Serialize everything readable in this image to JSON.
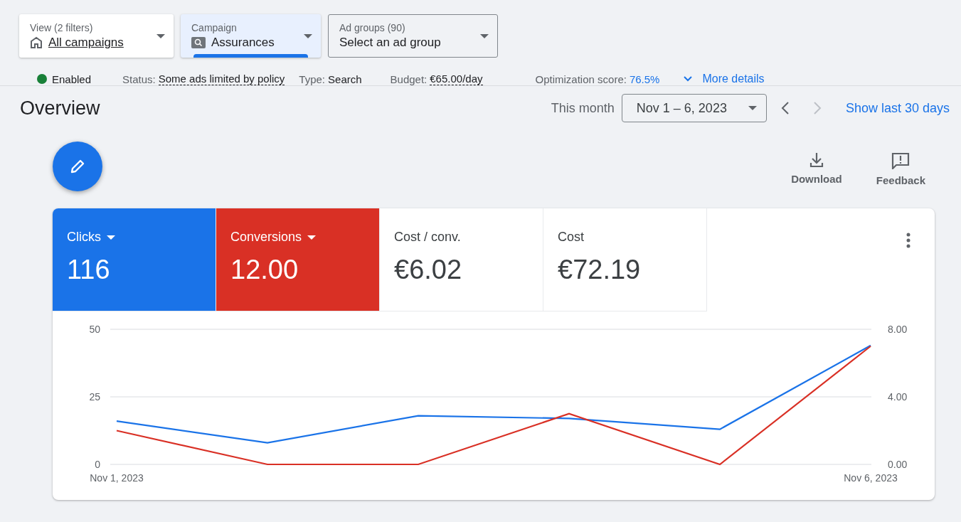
{
  "filters": [
    {
      "kind": "view",
      "label": "View (2 filters)",
      "value": "All campaigns",
      "selected": false
    },
    {
      "kind": "campaign",
      "label": "Campaign",
      "value": "Assurances",
      "selected": true
    },
    {
      "kind": "plain",
      "label": "Ad groups (90)",
      "value": "Select an ad group",
      "selected": false
    }
  ],
  "status_bar": {
    "state": "Enabled",
    "enabled": true,
    "status_label": "Status:",
    "status": "Some ads limited by policy",
    "type_label": "Type:",
    "type": "Search",
    "budget_label": "Budget:",
    "budget": "€65.00/day",
    "score_label": "Optimization score:",
    "score": "76.5%",
    "more": "More details"
  },
  "overview": {
    "title": "Overview",
    "range_label": "This month",
    "range": "Nov 1 – 6, 2023",
    "prev_disabled": false,
    "next_disabled": true,
    "show_last": "Show last 30 days"
  },
  "actions": [
    {
      "kind": "download",
      "label": "Download"
    },
    {
      "kind": "feedback",
      "label": "Feedback"
    }
  ],
  "metrics": [
    {
      "name": "Clicks",
      "value": "116",
      "selected": true,
      "color": "#1a73e8"
    },
    {
      "name": "Conversions",
      "value": "12.00",
      "selected": true,
      "color": "#d93025"
    },
    {
      "name": "Cost / conv.",
      "value": "€6.02",
      "selected": false
    },
    {
      "name": "Cost",
      "value": "€72.19",
      "selected": false
    }
  ],
  "chart_data": {
    "type": "line",
    "categories": [
      "Nov 1, 2023",
      null,
      null,
      null,
      null,
      "Nov 6, 2023"
    ],
    "ylim": [
      0,
      50
    ],
    "yticks": [
      0,
      25,
      50
    ],
    "y2lim": [
      0,
      8
    ],
    "y2ticks": [
      {
        "value": 0,
        "label": "0.00"
      },
      {
        "value": 4,
        "label": "4.00"
      },
      {
        "value": 8,
        "label": "8.00"
      }
    ],
    "series": [
      {
        "color": "#1a73e8",
        "values": [
          16,
          8,
          18,
          17,
          13,
          44
        ]
      },
      {
        "color": "#d93025",
        "axis": "y2",
        "values": [
          2,
          0,
          0,
          3,
          0,
          7
        ]
      }
    ]
  }
}
